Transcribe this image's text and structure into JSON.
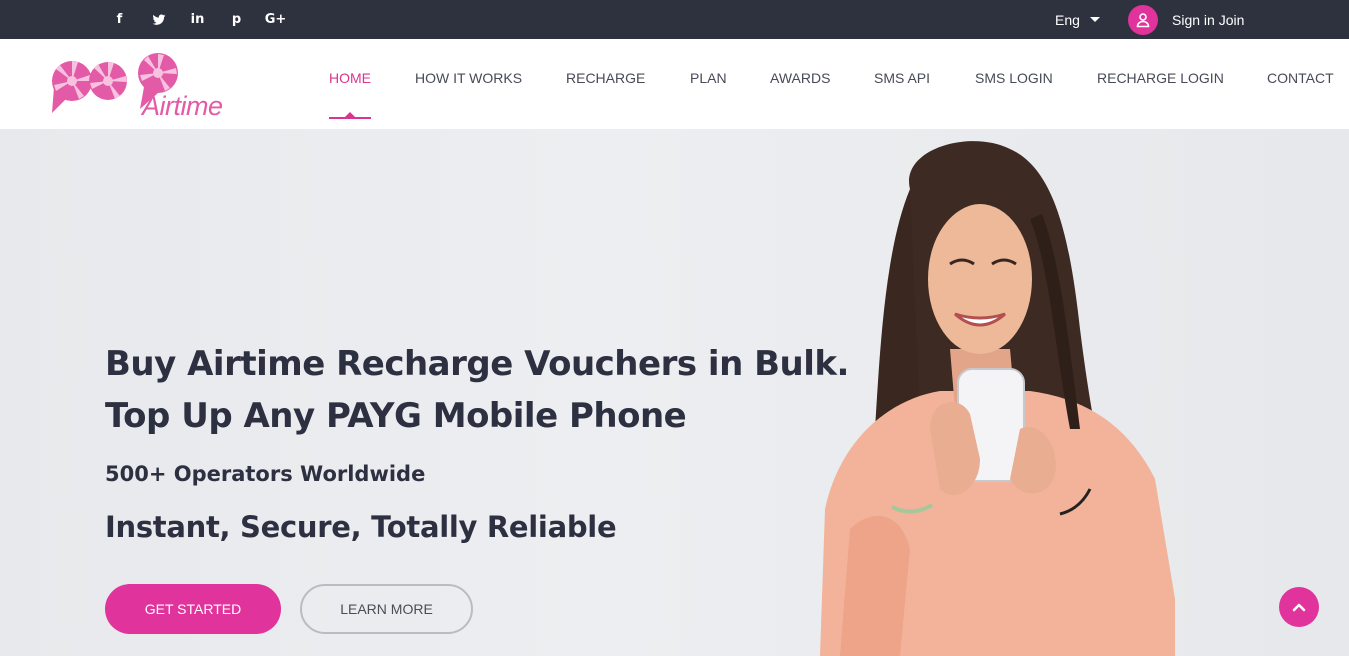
{
  "topbar": {
    "social": [
      {
        "icon": "facebook-icon",
        "glyph": "f"
      },
      {
        "icon": "twitter-icon",
        "glyph": ""
      },
      {
        "icon": "linkedin-icon",
        "glyph": "in"
      },
      {
        "icon": "pinterest-icon",
        "glyph": "p"
      },
      {
        "icon": "google-plus-icon",
        "glyph": "G+"
      }
    ],
    "language": "Eng",
    "signin_label": "Sign in Join"
  },
  "logo": {
    "text": "Airtime"
  },
  "nav": {
    "items": [
      {
        "label": "HOME",
        "active": true
      },
      {
        "label": "HOW IT WORKS"
      },
      {
        "label": "RECHARGE"
      },
      {
        "label": "PLAN"
      },
      {
        "label": "AWARDS"
      },
      {
        "label": "SMS API"
      },
      {
        "label": "SMS LOGIN"
      },
      {
        "label": "RECHARGE LOGIN"
      },
      {
        "label": "CONTACT"
      }
    ]
  },
  "hero": {
    "headline_1": "Buy Airtime Recharge Vouchers in Bulk.",
    "headline_2": "Top Up Any PAYG Mobile Phone",
    "subheadline": "500+ Operators Worldwide",
    "tagline": "Instant, Secure, Totally Reliable",
    "primary_button": "GET STARTED",
    "secondary_button": "LEARN MORE"
  },
  "colors": {
    "accent": "#e0339b",
    "topbar_bg": "#2e323f",
    "text_dark": "#2d3040"
  }
}
